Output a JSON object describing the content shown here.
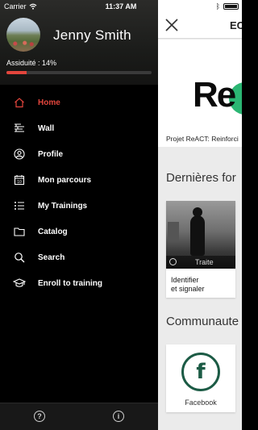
{
  "status_bar": {
    "carrier": "Carrier",
    "time": "11:37 AM"
  },
  "drawer": {
    "user_name": "Jenny Smith",
    "assiduite_label": "Assiduité : 14%",
    "assiduite_value": 14,
    "menu": [
      {
        "label": "Home",
        "icon": "home-icon",
        "active": true
      },
      {
        "label": "Wall",
        "icon": "wall-icon",
        "active": false
      },
      {
        "label": "Profile",
        "icon": "profile-icon",
        "active": false
      },
      {
        "label": "Mon parcours",
        "icon": "calendar-icon",
        "active": false
      },
      {
        "label": "My Trainings",
        "icon": "list-icon",
        "active": false
      },
      {
        "label": "Catalog",
        "icon": "folder-icon",
        "active": false
      },
      {
        "label": "Search",
        "icon": "search-icon",
        "active": false
      },
      {
        "label": "Enroll to training",
        "icon": "graduation-cap-icon",
        "active": false
      }
    ],
    "footer": {
      "help_icon": "?",
      "info_icon": "i"
    }
  },
  "content": {
    "title": "EC",
    "banner": {
      "logo_text": "Re",
      "caption": "Projet ReACT: Reinforci"
    },
    "section_trainings": "Dernières for",
    "training": {
      "overlay": "Traite",
      "title_line1": "Identifier",
      "title_line2": "et signaler"
    },
    "section_community": "Communaute",
    "community": {
      "glyph": "f",
      "label": "Facebook"
    }
  },
  "colors": {
    "accent": "#e2453c",
    "drawer_bg": "#000000",
    "logo_green": "#2bb673",
    "fb_green": "#1c5b45"
  }
}
